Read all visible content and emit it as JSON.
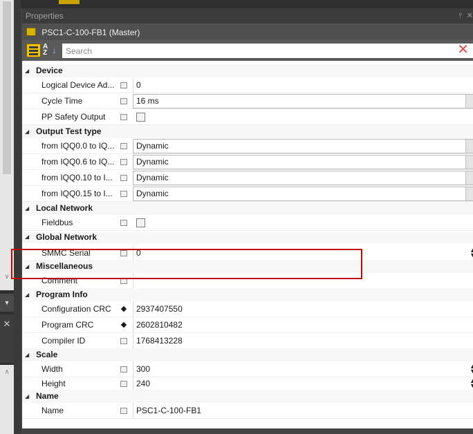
{
  "panel": {
    "title": "Properties",
    "pin_glyph": "⫯",
    "close_glyph": "✕",
    "object_label": "PSC1-C-100-FB1 (Master)"
  },
  "toolbar": {
    "search_placeholder": "Search",
    "alpha_top": "A",
    "alpha_bottom": "Z",
    "clear_glyph": "✕"
  },
  "grid": {
    "categories": {
      "device": "Device",
      "output_test": "Output Test type",
      "local_network": "Local Network",
      "global_network": "Global Network",
      "misc": "Miscellaneous",
      "program_info": "Program Info",
      "scale": "Scale",
      "name": "Name"
    },
    "rows": {
      "logical_device_address": {
        "name": "Logical Device Ad...",
        "value": "0"
      },
      "cycle_time": {
        "name": "Cycle Time",
        "value": "16 ms"
      },
      "pp_safety_output": {
        "name": "PP Safety Output",
        "checked": false
      },
      "iqq0_0": {
        "name": "from IQQ0.0 to IQ...",
        "value": "Dynamic"
      },
      "iqq0_6": {
        "name": "from IQQ0.6 to IQ...",
        "value": "Dynamic"
      },
      "iqq0_10": {
        "name": "from IQQ0.10 to I...",
        "value": "Dynamic"
      },
      "iqq0_15": {
        "name": "from IQQ0.15 to I...",
        "value": "Dynamic"
      },
      "fieldbus": {
        "name": "Fieldbus",
        "checked": false
      },
      "smmc_serial": {
        "name": "SMMC Serial",
        "value": "0"
      },
      "comment": {
        "name": "Comment",
        "value": ""
      },
      "configuration_crc": {
        "name": "Configuration CRC",
        "value": "2937407550"
      },
      "program_crc": {
        "name": "Program CRC",
        "value": "2602810482"
      },
      "compiler_id": {
        "name": "Compiler ID",
        "value": "1768413228"
      },
      "width": {
        "name": "Width",
        "value": "300"
      },
      "height": {
        "name": "Height",
        "value": "240"
      },
      "name": {
        "name": "Name",
        "value": "PSC1-C-100-FB1"
      }
    }
  },
  "colors": {
    "highlight": "#c00000",
    "object_icon": "#d7b400",
    "clear": "#e04b4b"
  }
}
